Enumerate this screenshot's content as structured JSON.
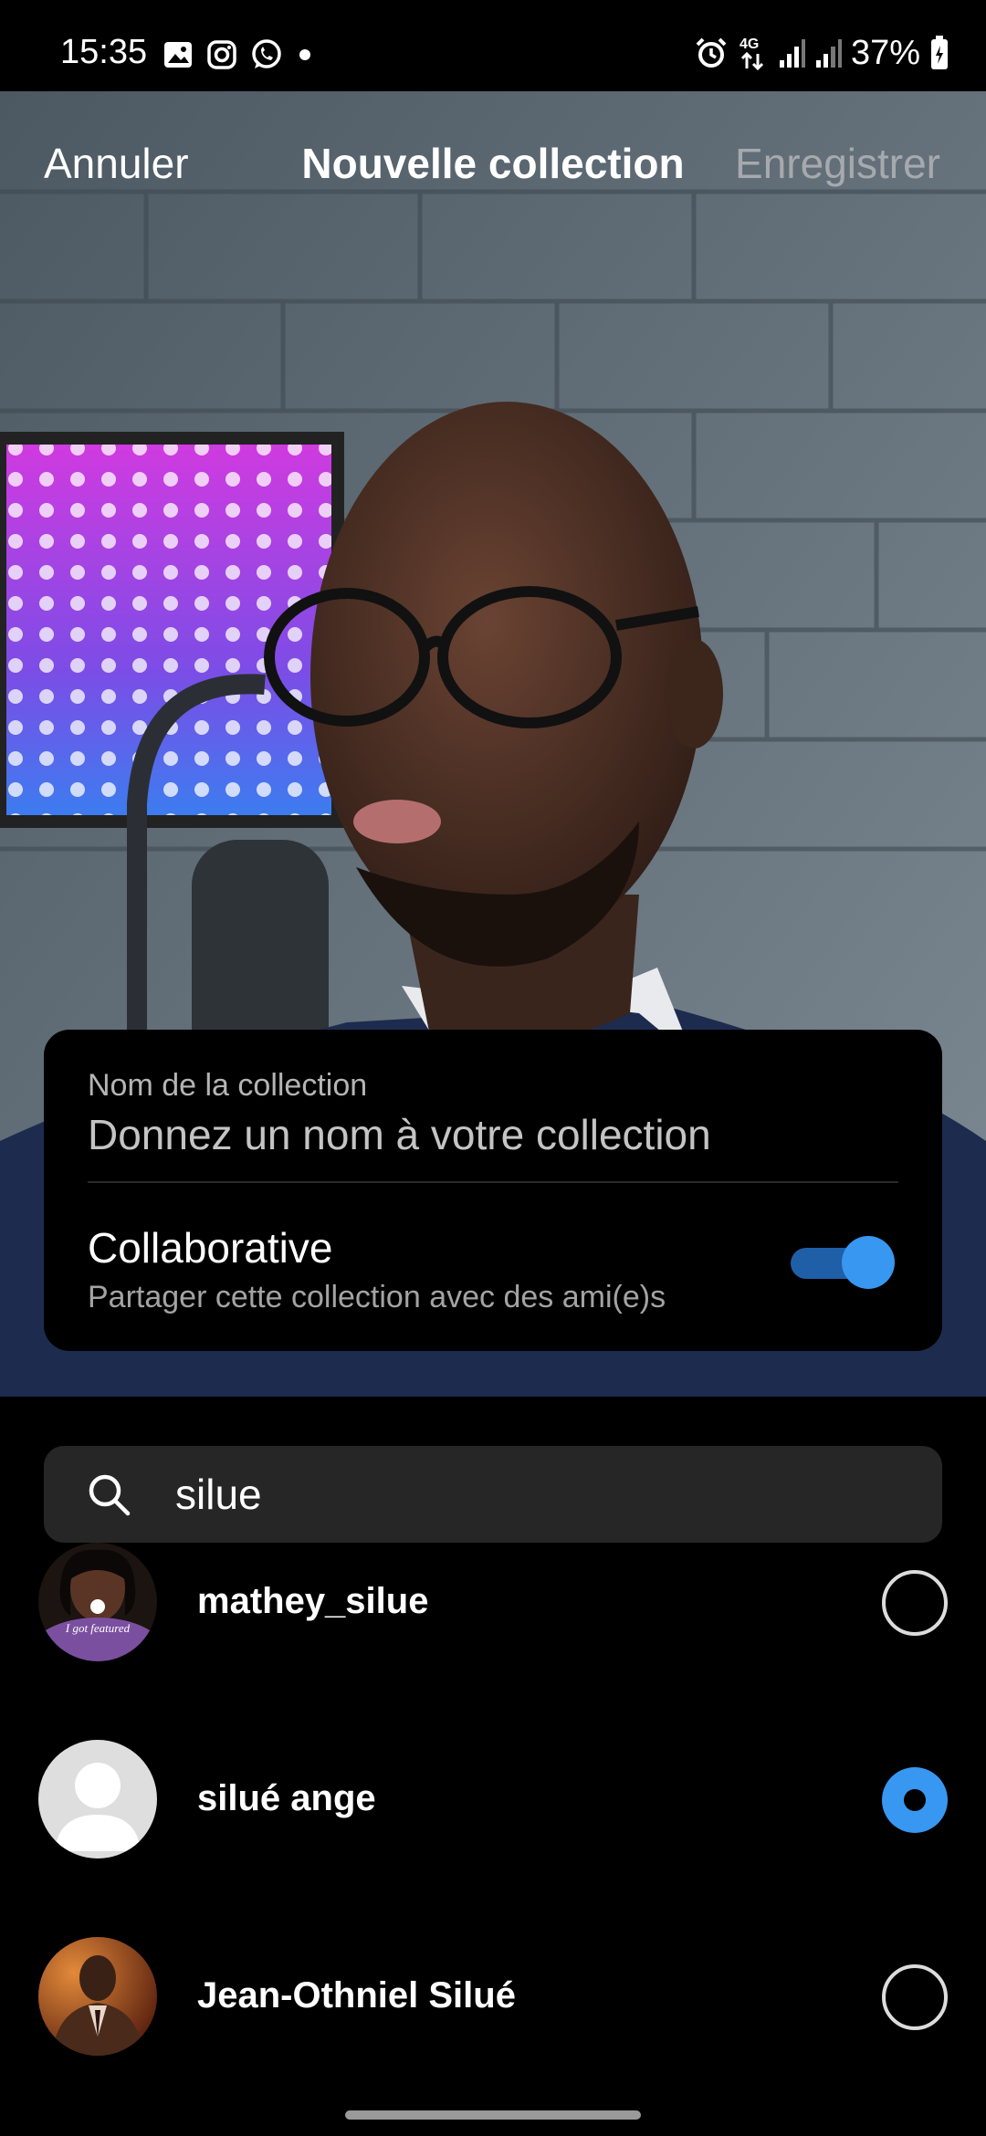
{
  "status_bar": {
    "time": "15:35",
    "left_icons": [
      "gallery-icon",
      "instagram-icon",
      "whatsapp-icon",
      "dot-icon"
    ],
    "right_icons": [
      "alarm-icon",
      "4g-icon",
      "signal-icon",
      "signal-icon",
      "battery-icon"
    ],
    "network_label": "4G",
    "battery": "37%"
  },
  "header": {
    "cancel_label": "Annuler",
    "title": "Nouvelle collection",
    "save_label": "Enregistrer"
  },
  "collection_card": {
    "name_label": "Nom de la collection",
    "name_placeholder": "Donnez un nom à votre collection",
    "collaborative_title": "Collaborative",
    "collaborative_subtitle": "Partager cette collection avec des ami(e)s",
    "collaborative_enabled": true
  },
  "search": {
    "query": "silue"
  },
  "results": [
    {
      "name": "mathey_silue",
      "selected": false,
      "avatar_caption": "I got featured"
    },
    {
      "name": "silué ange",
      "selected": true
    },
    {
      "name": "Jean-Othniel Silué",
      "selected": false
    }
  ],
  "colors": {
    "accent_blue": "#3897f0",
    "toggle_track": "#1f5fa8",
    "save_disabled": "#a6a9ad",
    "search_bg": "#262626"
  }
}
